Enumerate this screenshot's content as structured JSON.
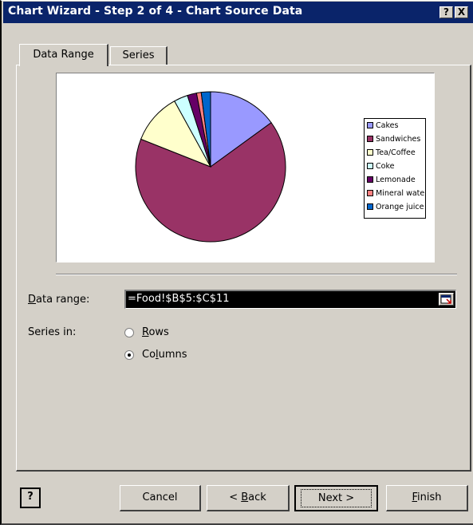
{
  "window": {
    "title": "Chart Wizard - Step 2 of 4 - Chart Source Data",
    "help_button": "?",
    "close_button": "X"
  },
  "tabs": [
    {
      "label": "Data Range",
      "active": true
    },
    {
      "label": "Series",
      "active": false
    }
  ],
  "chart_data": {
    "type": "pie",
    "categories": [
      "Cakes",
      "Sandwiches",
      "Tea/Coffee",
      "Coke",
      "Lemonade",
      "Mineral wate",
      "Orange juice"
    ],
    "values": [
      15,
      66,
      11,
      3,
      2,
      1,
      2
    ],
    "colors": [
      "#9999ff",
      "#993366",
      "#ffffcc",
      "#ccffff",
      "#660066",
      "#ff8080",
      "#0066cc"
    ],
    "legend_position": "right"
  },
  "form": {
    "data_range_label_u": "D",
    "data_range_label_rest": "ata range:",
    "data_range_value": "=Food!$B$5:$C$11",
    "series_in_label": "Series in:",
    "radio_rows_u": "R",
    "radio_rows_rest": "ows",
    "radio_columns_pre": "Co",
    "radio_columns_u": "l",
    "radio_columns_rest": "umns",
    "series_in_selected": "Columns"
  },
  "buttons": {
    "help_icon": "?",
    "cancel": "Cancel",
    "back_pre": "< ",
    "back_u": "B",
    "back_rest": "ack",
    "next": "Next >",
    "finish_u": "F",
    "finish_rest": "inish"
  }
}
